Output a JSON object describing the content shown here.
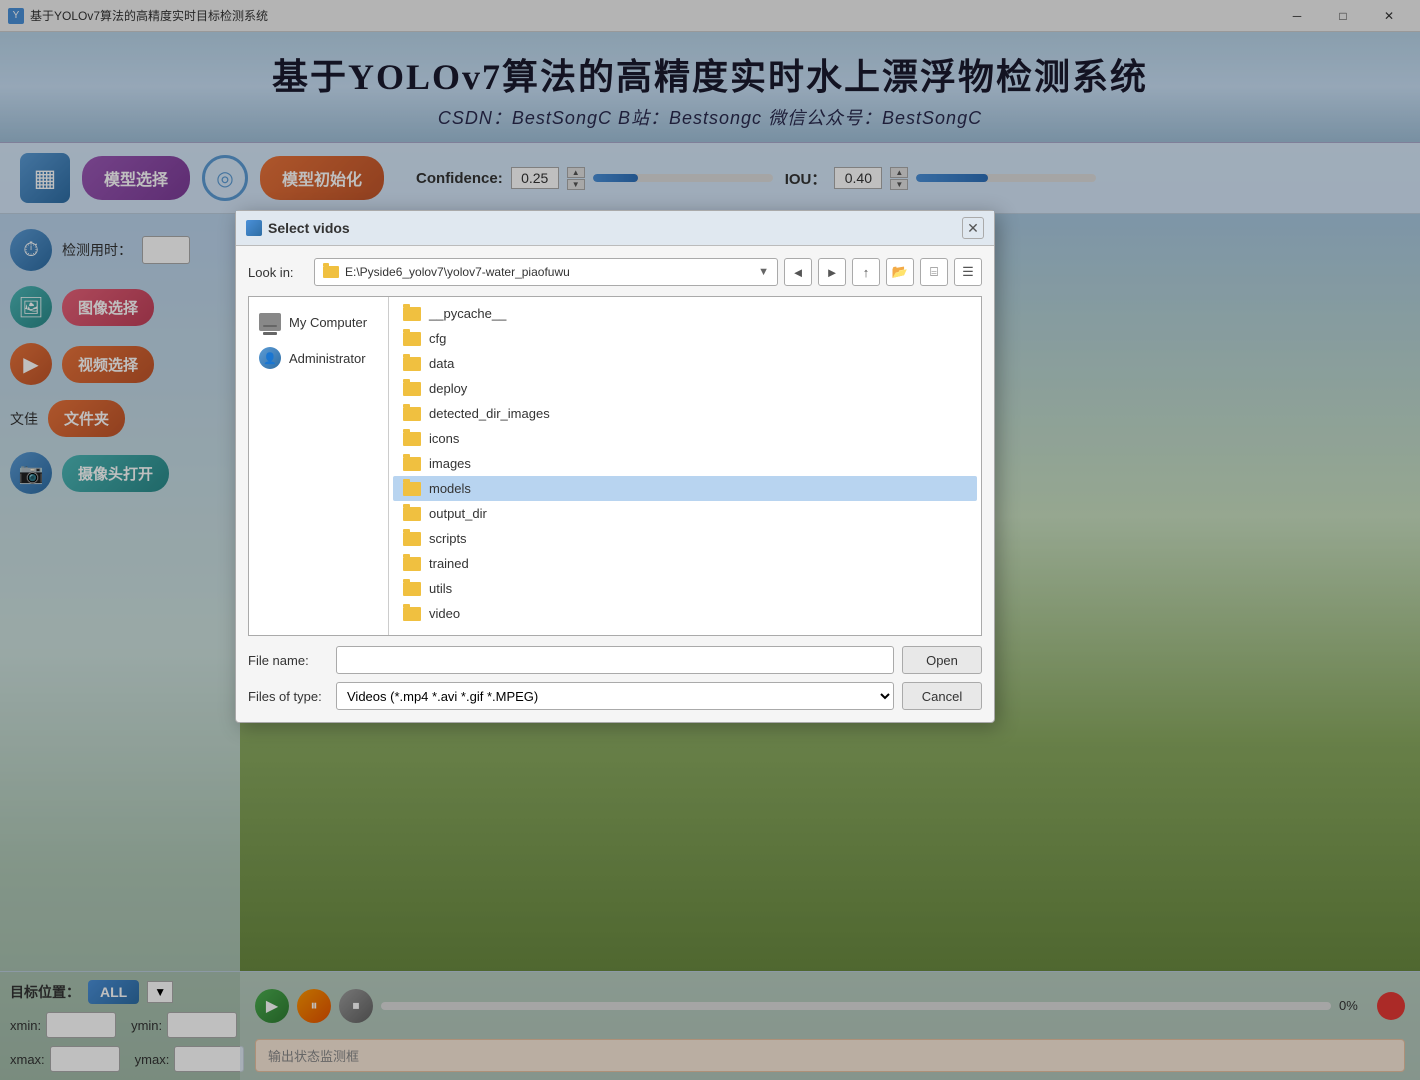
{
  "window": {
    "title": "基于YOLOv7算法的高精度实时目标检测系统",
    "minimize_label": "─",
    "maximize_label": "□",
    "close_label": "✕"
  },
  "header": {
    "title": "基于YOLOv7算法的高精度实时水上漂浮物检测系统",
    "subtitle": "CSDN：BestSongC  B站：Bestsongc  微信公众号：BestSongC"
  },
  "toolbar": {
    "model_select_label": "模型选择",
    "model_init_label": "模型初始化",
    "confidence_label": "Confidence:",
    "confidence_value": "0.25",
    "iou_label": "IOU：",
    "iou_value": "0.40",
    "confidence_progress": 25,
    "iou_progress": 40
  },
  "sidebar": {
    "detect_time_label": "检测用时：",
    "image_select_label": "图像选择",
    "video_select_label": "视频选择",
    "folder_label": "文佳",
    "folder_btn_label": "文件夹",
    "camera_btn_label": "摄像头打开"
  },
  "bottom_left": {
    "target_label": "目标位置：",
    "all_label": "ALL",
    "xmin_label": "xmin:",
    "xmax_label": "xmax:",
    "ymin_label": "ymin:",
    "ymax_label": "ymax:"
  },
  "bottom_right": {
    "play_label": "▶",
    "pause_label": "⏸",
    "stop_label": "⏹",
    "progress_percent": "0%",
    "status_placeholder": "输出状态监测框"
  },
  "dialog": {
    "title": "Select vidos",
    "look_in_label": "Look in:",
    "look_in_path": "E:\\Pyside6_yolov7\\yolov7-water_piaofuwu",
    "sidebar_items": [
      {
        "label": "My Computer",
        "type": "computer"
      },
      {
        "label": "Administrator",
        "type": "admin"
      }
    ],
    "file_items": [
      {
        "name": "__pycache__",
        "selected": false
      },
      {
        "name": "cfg",
        "selected": false
      },
      {
        "name": "data",
        "selected": false
      },
      {
        "name": "deploy",
        "selected": false
      },
      {
        "name": "detected_dir_images",
        "selected": false
      },
      {
        "name": "icons",
        "selected": false
      },
      {
        "name": "images",
        "selected": false
      },
      {
        "name": "models",
        "selected": true
      },
      {
        "name": "output_dir",
        "selected": false
      },
      {
        "name": "scripts",
        "selected": false
      },
      {
        "name": "trained",
        "selected": false
      },
      {
        "name": "utils",
        "selected": false
      },
      {
        "name": "video",
        "selected": false
      }
    ],
    "filename_label": "File name:",
    "filename_value": "",
    "filetype_label": "Files of type:",
    "filetype_value": "Videos (*.mp4 *.avi *.gif *.MPEG)",
    "open_btn_label": "Open",
    "cancel_btn_label": "Cancel",
    "close_icon": "✕"
  }
}
